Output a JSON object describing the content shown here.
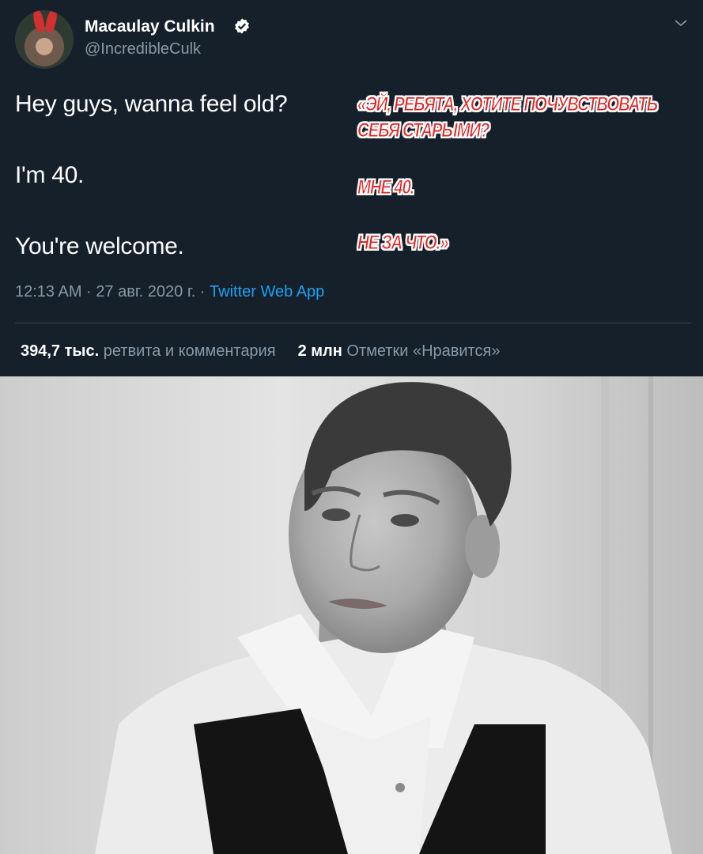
{
  "tweet": {
    "author_name": "Macaulay Culkin",
    "author_handle": "@IncredibleCulk",
    "lines": [
      "Hey guys, wanna feel old?",
      "I'm 40.",
      "You're welcome."
    ],
    "timestamp": "12:13 AM · 27 авг. 2020 г. · ",
    "source_app": "Twitter Web App",
    "retweets_count": "394,7 тыс.",
    "retweets_label": " ретвита и комментария",
    "likes_count": "2 млн",
    "likes_label": " Отметки «Нравится»"
  },
  "translation": {
    "line1": "«ЭЙ, РЕБЯТА, ХОТИТЕ ПОЧУВСТВОВАТЬ",
    "line2": "СЕБЯ СТАРЫМИ?",
    "line3": "МНЕ 40.",
    "line4": "НЕ ЗА ЧТО.»"
  },
  "icons": {
    "verified": "verified-badge-icon",
    "menu": "chevron-down-icon"
  },
  "colors": {
    "background": "#15202b",
    "muted_text": "#8899a6",
    "link": "#1da1f2",
    "translation_text": "#e52222"
  }
}
